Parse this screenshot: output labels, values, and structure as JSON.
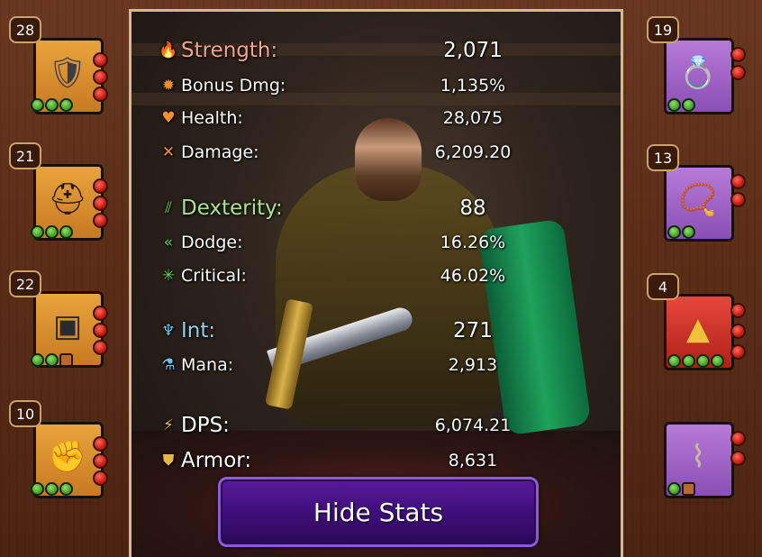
{
  "stats": {
    "strength": {
      "label": "Strength:",
      "value": "2,071"
    },
    "bonus_dmg": {
      "label": "Bonus Dmg:",
      "value": "1,135%"
    },
    "health": {
      "label": "Health:",
      "value": "28,075"
    },
    "damage": {
      "label": "Damage:",
      "value": "6,209.20"
    },
    "dexterity": {
      "label": "Dexterity:",
      "value": "88"
    },
    "dodge": {
      "label": "Dodge:",
      "value": "16.26%"
    },
    "critical": {
      "label": "Critical:",
      "value": "46.02%"
    },
    "int": {
      "label": "Int:",
      "value": "271"
    },
    "mana": {
      "label": "Mana:",
      "value": "2,913"
    },
    "dps": {
      "label": "DPS:",
      "value": "6,074.21"
    },
    "armor": {
      "label": "Armor:",
      "value": "8,631"
    }
  },
  "hide_button": {
    "label": "Hide Stats"
  },
  "left_slots": [
    {
      "level": "28",
      "item_icon": "shield-weapon-icon"
    },
    {
      "level": "21",
      "item_icon": "helmet-icon"
    },
    {
      "level": "22",
      "item_icon": "chest-armor-icon"
    },
    {
      "level": "10",
      "item_icon": "gauntlet-icon"
    }
  ],
  "right_slots": [
    {
      "level": "19",
      "item_icon": "ring-icon"
    },
    {
      "level": "13",
      "item_icon": "necklace-icon"
    },
    {
      "level": "4",
      "item_icon": "charm-icon"
    },
    {
      "item_icon": "bracer-icon"
    }
  ],
  "colors": {
    "strength": "#f4a48a",
    "dexterity": "#a9e38e",
    "int": "#8fd2f0",
    "button": "#3f0f7a",
    "panel_border": "#d7b98a"
  }
}
